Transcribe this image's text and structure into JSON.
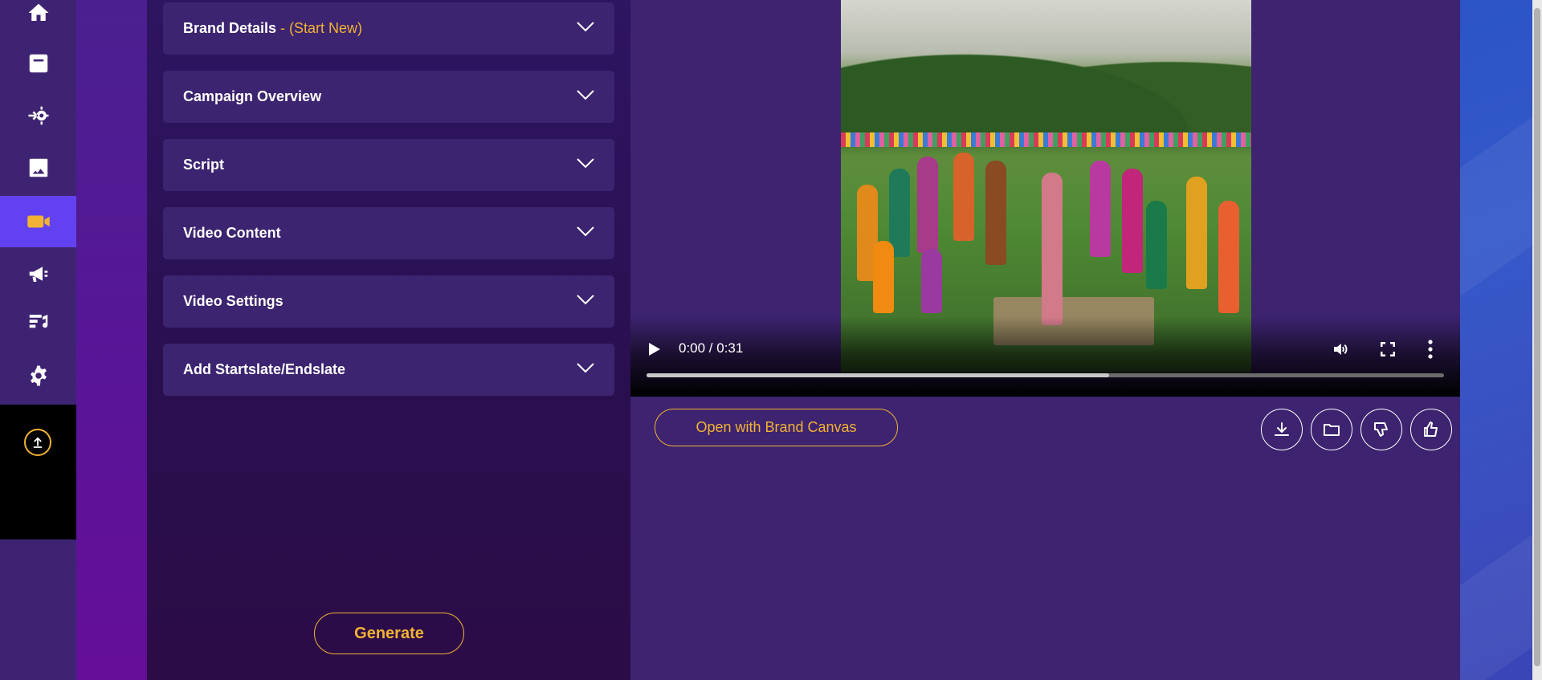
{
  "rail": {
    "items": [
      {
        "name": "home-icon"
      },
      {
        "name": "document-icon"
      },
      {
        "name": "automation-gear-icon"
      },
      {
        "name": "image-icon"
      },
      {
        "name": "video-camera-icon",
        "active": true
      },
      {
        "name": "megaphone-icon"
      },
      {
        "name": "music-notes-icon"
      },
      {
        "name": "settings-gear-icon"
      }
    ],
    "upload_icon": "upload-icon"
  },
  "form": {
    "sections": [
      {
        "title": "Brand Details",
        "suffix": " - (Start New)"
      },
      {
        "title": "Campaign Overview",
        "suffix": ""
      },
      {
        "title": "Script",
        "suffix": ""
      },
      {
        "title": "Video Content",
        "suffix": ""
      },
      {
        "title": "Video Settings",
        "suffix": ""
      },
      {
        "title": "Add Startslate/Endslate",
        "suffix": ""
      }
    ],
    "generate_label": "Generate"
  },
  "video": {
    "time_display": "0:00 / 0:31",
    "buffered_fraction": 0.58
  },
  "actions": {
    "open_canvas_label": "Open with Brand Canvas",
    "icons": [
      "download-icon",
      "folder-icon",
      "thumbs-down-icon",
      "thumbs-up-icon"
    ]
  },
  "colors": {
    "accent": "#f2b233",
    "active_rail": "#6242f0",
    "panel": "#3c2470"
  }
}
